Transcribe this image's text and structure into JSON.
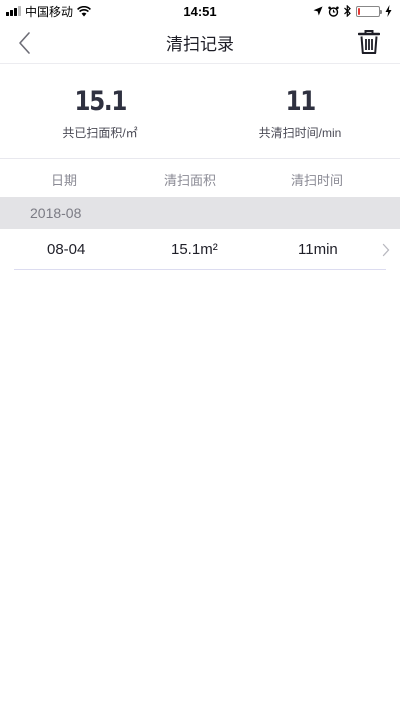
{
  "status_bar": {
    "carrier": "中国移动",
    "time": "14:51"
  },
  "nav": {
    "title": "清扫记录",
    "back_icon": "chevron-left-icon",
    "delete_icon": "trash-icon"
  },
  "summary": {
    "area_value": "15.1",
    "area_label": "共已扫面积/㎡",
    "time_value": "11",
    "time_label": "共清扫时间/min"
  },
  "table": {
    "headers": [
      "日期",
      "清扫面积",
      "清扫时间"
    ],
    "groups": [
      {
        "month": "2018-08",
        "records": [
          {
            "date": "08-04",
            "area": "15.1m²",
            "duration": "11min"
          }
        ]
      }
    ]
  },
  "colors": {
    "accent_divider": "#dcdcf0",
    "month_bg": "#e3e3e6",
    "battery_low": "#e53935"
  }
}
